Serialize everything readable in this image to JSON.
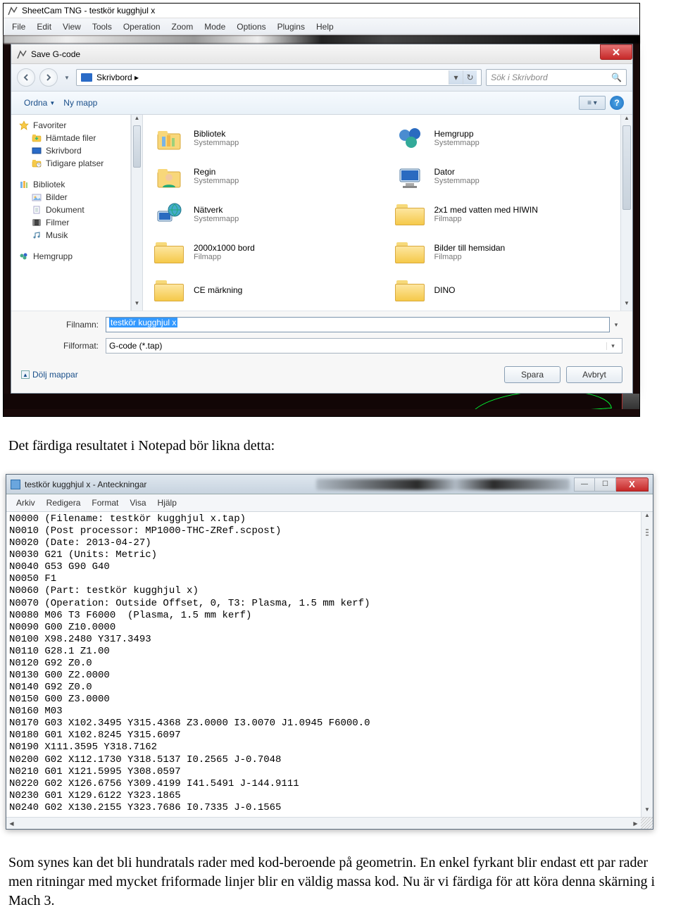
{
  "sheetcam": {
    "title": "SheetCam TNG - testkör kugghjul x",
    "menu": [
      "File",
      "Edit",
      "View",
      "Tools",
      "Operation",
      "Zoom",
      "Mode",
      "Options",
      "Plugins",
      "Help"
    ]
  },
  "dialog": {
    "title": "Save G-code",
    "breadcrumb": "Skrivbord",
    "breadcrumb_chevron": "▸",
    "search_placeholder": "Sök i Skrivbord",
    "toolbar": {
      "organize": "Ordna",
      "newfolder": "Ny mapp"
    },
    "sidebar": {
      "favorites": {
        "label": "Favoriter",
        "items": [
          "Hämtade filer",
          "Skrivbord",
          "Tidigare platser"
        ]
      },
      "libraries": {
        "label": "Bibliotek",
        "items": [
          "Bilder",
          "Dokument",
          "Filmer",
          "Musik"
        ]
      },
      "homegroup": {
        "label": "Hemgrupp"
      }
    },
    "files": [
      {
        "name": "Bibliotek",
        "type": "Systemmapp",
        "icon": "library"
      },
      {
        "name": "Hemgrupp",
        "type": "Systemmapp",
        "icon": "homegroup"
      },
      {
        "name": "Regin",
        "type": "Systemmapp",
        "icon": "user"
      },
      {
        "name": "Dator",
        "type": "Systemmapp",
        "icon": "computer"
      },
      {
        "name": "Nätverk",
        "type": "Systemmapp",
        "icon": "network"
      },
      {
        "name": "2x1 med vatten med HIWIN",
        "type": "Filmapp",
        "icon": "folder"
      },
      {
        "name": "2000x1000 bord",
        "type": "Filmapp",
        "icon": "folder"
      },
      {
        "name": "Bilder till hemsidan",
        "type": "Filmapp",
        "icon": "folder"
      },
      {
        "name": "CE märkning",
        "type": "",
        "icon": "folder"
      },
      {
        "name": "DINO",
        "type": "",
        "icon": "folder"
      }
    ],
    "filename_label": "Filnamn:",
    "filename_value": "testkör kugghjul x",
    "format_label": "Filformat:",
    "format_value": "G-code (*.tap)",
    "hide_folders": "Dölj mappar",
    "save_btn": "Spara",
    "cancel_btn": "Avbryt"
  },
  "doc": {
    "caption1": "Det färdiga resultatet i Notepad bör likna detta:",
    "para2": "Som synes kan det bli hundratals rader med kod-beroende på geometrin. En enkel fyrkant blir endast ett par rader men ritningar med mycket friformade linjer blir en väldig massa kod. Nu är vi färdiga för att köra denna skärning i Mach 3."
  },
  "notepad": {
    "title": "testkör kugghjul x - Anteckningar",
    "menu": [
      "Arkiv",
      "Redigera",
      "Format",
      "Visa",
      "Hjälp"
    ],
    "content": "N0000 (Filename: testkör kugghjul x.tap)\nN0010 (Post processor: MP1000-THC-ZRef.scpost)\nN0020 (Date: 2013-04-27)\nN0030 G21 (Units: Metric)\nN0040 G53 G90 G40\nN0050 F1\nN0060 (Part: testkör kugghjul x)\nN0070 (Operation: Outside Offset, 0, T3: Plasma, 1.5 mm kerf)\nN0080 M06 T3 F6000  (Plasma, 1.5 mm kerf)\nN0090 G00 Z10.0000\nN0100 X98.2480 Y317.3493\nN0110 G28.1 Z1.00\nN0120 G92 Z0.0\nN0130 G00 Z2.0000\nN0140 G92 Z0.0\nN0150 G00 Z3.0000\nN0160 M03\nN0170 G03 X102.3495 Y315.4368 Z3.0000 I3.0070 J1.0945 F6000.0\nN0180 G01 X102.8245 Y315.6097\nN0190 X111.3595 Y318.7162\nN0200 G02 X112.1730 Y318.5137 I0.2565 J-0.7048\nN0210 G01 X121.5995 Y308.0597\nN0220 G02 X126.6756 Y309.4199 I41.5491 J-144.9111\nN0230 G01 X129.6122 Y323.1865\nN0240 G02 X130.2155 Y323.7686 I0.7335 J-0.1565"
  }
}
